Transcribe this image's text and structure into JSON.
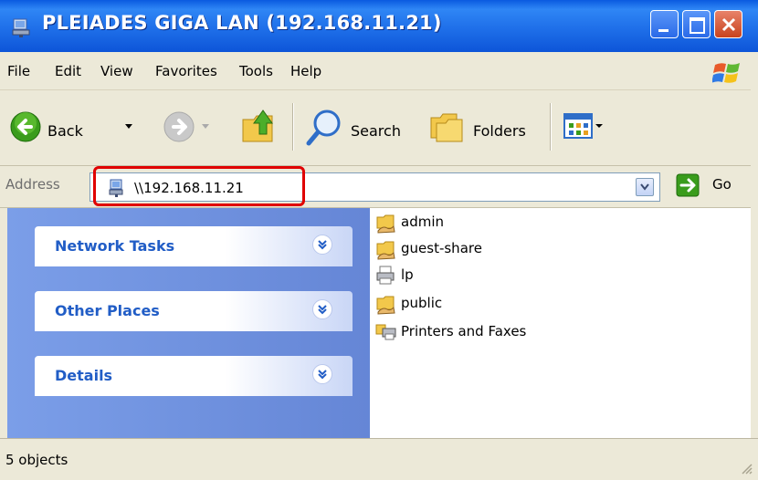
{
  "window": {
    "title": "PLEIADES GIGA LAN (192.168.11.21)"
  },
  "menu": {
    "items": [
      "File",
      "Edit",
      "View",
      "Favorites",
      "Tools",
      "Help"
    ]
  },
  "toolbar": {
    "back_label": "Back",
    "search_label": "Search",
    "folders_label": "Folders"
  },
  "address": {
    "label": "Address",
    "value": "\\\\192.168.11.21",
    "go_label": "Go"
  },
  "taskpane": {
    "panels": [
      {
        "title": "Network Tasks"
      },
      {
        "title": "Other Places"
      },
      {
        "title": "Details"
      }
    ]
  },
  "files": [
    {
      "name": "admin",
      "icon": "shared-folder-icon"
    },
    {
      "name": "guest-share",
      "icon": "shared-folder-icon"
    },
    {
      "name": "lp",
      "icon": "printer-icon"
    },
    {
      "name": "public",
      "icon": "shared-folder-icon"
    },
    {
      "name": "Printers and Faxes",
      "icon": "printers-faxes-icon"
    }
  ],
  "status": {
    "text": "5 objects"
  },
  "colors": {
    "titlebar": "#0a5ae0",
    "highlight": "#e00000",
    "panel_title": "#215dc6"
  }
}
